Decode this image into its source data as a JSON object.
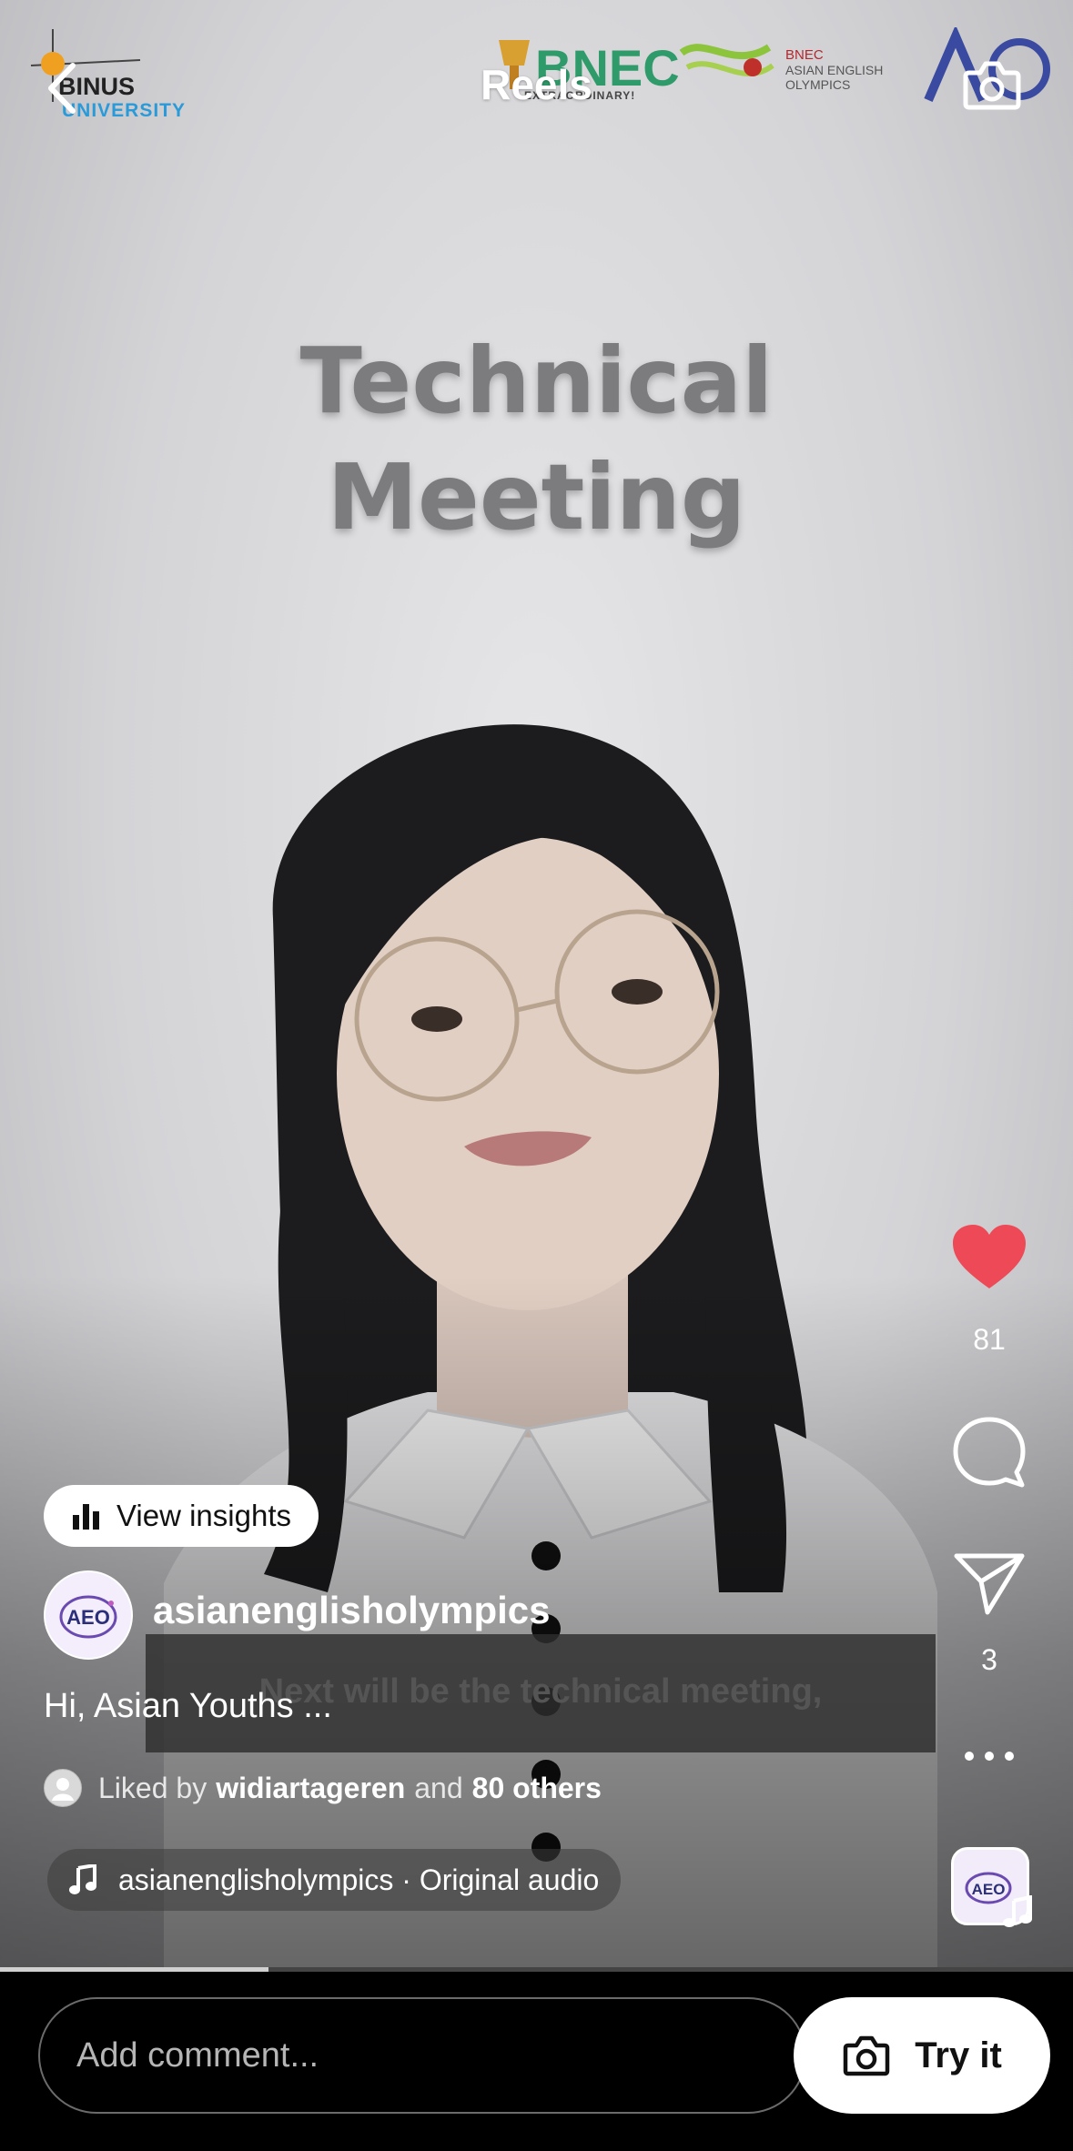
{
  "header": {
    "title": "Reels",
    "back_icon": "chevron-left-icon",
    "camera_icon": "camera-icon"
  },
  "video": {
    "headline_line1": "Technical",
    "headline_line2": "Meeting",
    "subtitle": "Next will be the technical meeting,",
    "sponsor_logos": {
      "binus_line1": "BINUS",
      "binus_line2": "UNIVERSITY",
      "bnec_name": "BNEC",
      "bnec_tagline": "EXTRAORDINARY!",
      "aeo_line1": "BNEC",
      "aeo_line2": "ASIAN ENGLISH OLYMPICS"
    }
  },
  "actions": {
    "like_count": "81",
    "share_count": "3",
    "like_color": "#ed4956"
  },
  "post": {
    "insights_label": "View insights",
    "username": "asianenglisholympics",
    "avatar_text": "AEO",
    "caption": "Hi, Asian Youths ...",
    "liked_prefix": "Liked by",
    "liked_user": "widiartageren",
    "liked_mid": "and",
    "liked_others": "80 others",
    "audio_label": "asianenglisholympics · Original audio",
    "audio_thumb_text": "AEO"
  },
  "playback": {
    "progress": 0.25
  },
  "footer": {
    "comment_placeholder": "Add comment...",
    "try_label": "Try it"
  }
}
